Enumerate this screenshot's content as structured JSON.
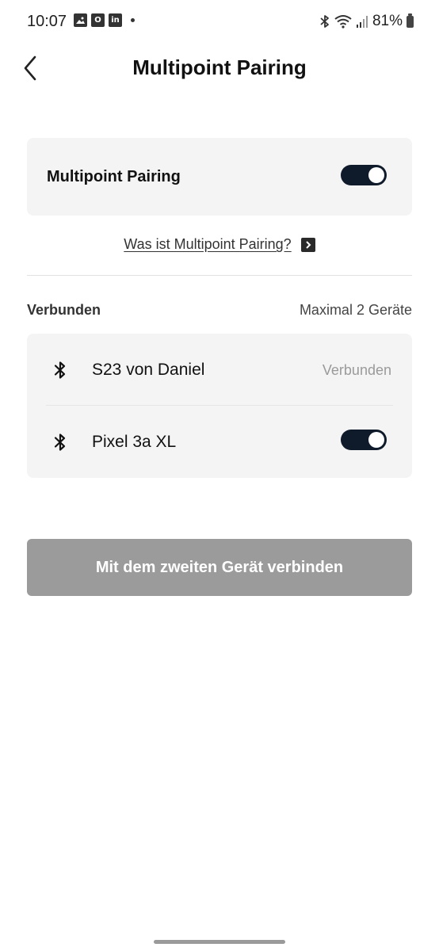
{
  "status_bar": {
    "time": "10:07",
    "notification_icons": [
      "image-icon",
      "outlook-icon",
      "linkedin-icon"
    ],
    "right_icons": [
      "bluetooth-icon",
      "wifi-icon",
      "signal-icon"
    ],
    "battery": "81%"
  },
  "header": {
    "title": "Multipoint Pairing",
    "back_icon": "chevron-left-icon"
  },
  "multipoint": {
    "label": "Multipoint Pairing",
    "enabled": true,
    "info_link": "Was ist Multipoint Pairing?"
  },
  "connected_section": {
    "label": "Verbunden",
    "limit_note": "Maximal 2 Geräte",
    "devices": [
      {
        "icon": "bluetooth-icon",
        "name": "S23 von Daniel",
        "status": "Verbunden"
      },
      {
        "icon": "bluetooth-icon",
        "name": "Pixel 3a XL",
        "enabled": true
      }
    ]
  },
  "actions": {
    "connect_second": "Mit dem zweiten Gerät verbinden"
  },
  "colors": {
    "toggle_on": "#0f1a2a",
    "card_bg": "#f4f4f4",
    "button_disabled": "#9b9b9b"
  }
}
